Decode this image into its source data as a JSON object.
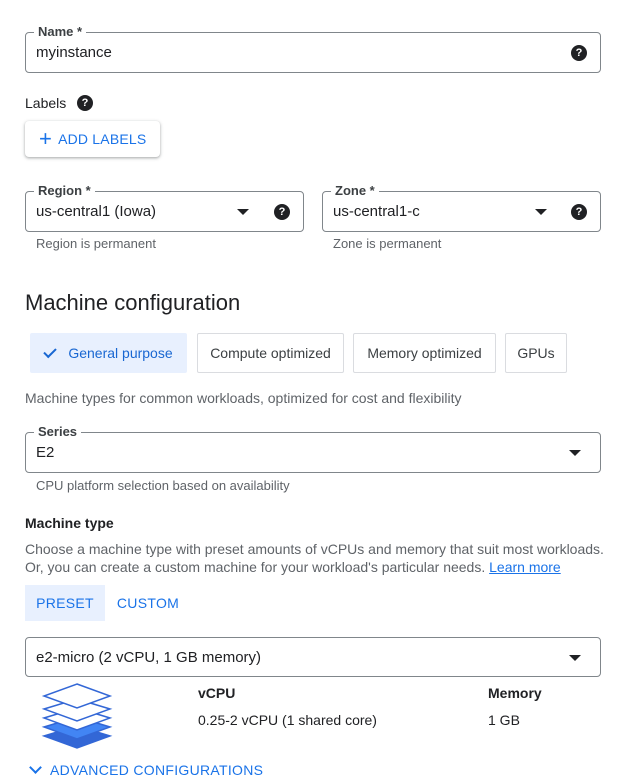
{
  "name_field": {
    "label": "Name *",
    "value": "myinstance",
    "help_icon": "help-circle-icon"
  },
  "labels": {
    "title": "Labels",
    "help_icon": "help-circle-icon",
    "add_button": "ADD LABELS"
  },
  "region_field": {
    "label": "Region *",
    "value": "us-central1 (Iowa)",
    "hint": "Region is permanent"
  },
  "zone_field": {
    "label": "Zone *",
    "value": "us-central1-c",
    "hint": "Zone is permanent"
  },
  "machine_config": {
    "title": "Machine configuration",
    "families": [
      {
        "label": "General purpose",
        "selected": true
      },
      {
        "label": "Compute optimized",
        "selected": false
      },
      {
        "label": "Memory optimized",
        "selected": false
      },
      {
        "label": "GPUs",
        "selected": false
      }
    ],
    "family_description": "Machine types for common workloads, optimized for cost and flexibility"
  },
  "series_field": {
    "label": "Series",
    "value": "E2",
    "hint": "CPU platform selection based on availability"
  },
  "machine_type": {
    "title": "Machine type",
    "description_line1": "Choose a machine type with preset amounts of vCPUs and memory that suit most workloads.",
    "description_line2": "Or, you can create a custom machine for your workload's particular needs.",
    "learn_more": "Learn more",
    "tabs": [
      {
        "label": "PRESET",
        "selected": true
      },
      {
        "label": "CUSTOM",
        "selected": false
      }
    ],
    "selected_type": "e2-micro (2 vCPU, 1 GB memory)",
    "vcpu_label": "vCPU",
    "vcpu_value": "0.25-2 vCPU (1 shared core)",
    "memory_label": "Memory",
    "memory_value": "1 GB"
  },
  "advanced": {
    "label": "ADVANCED CONFIGURATIONS"
  },
  "colors": {
    "accent": "#1a73e8",
    "selected_bg": "#e8f0fe",
    "border": "#80868b",
    "hint": "#5f6368"
  }
}
